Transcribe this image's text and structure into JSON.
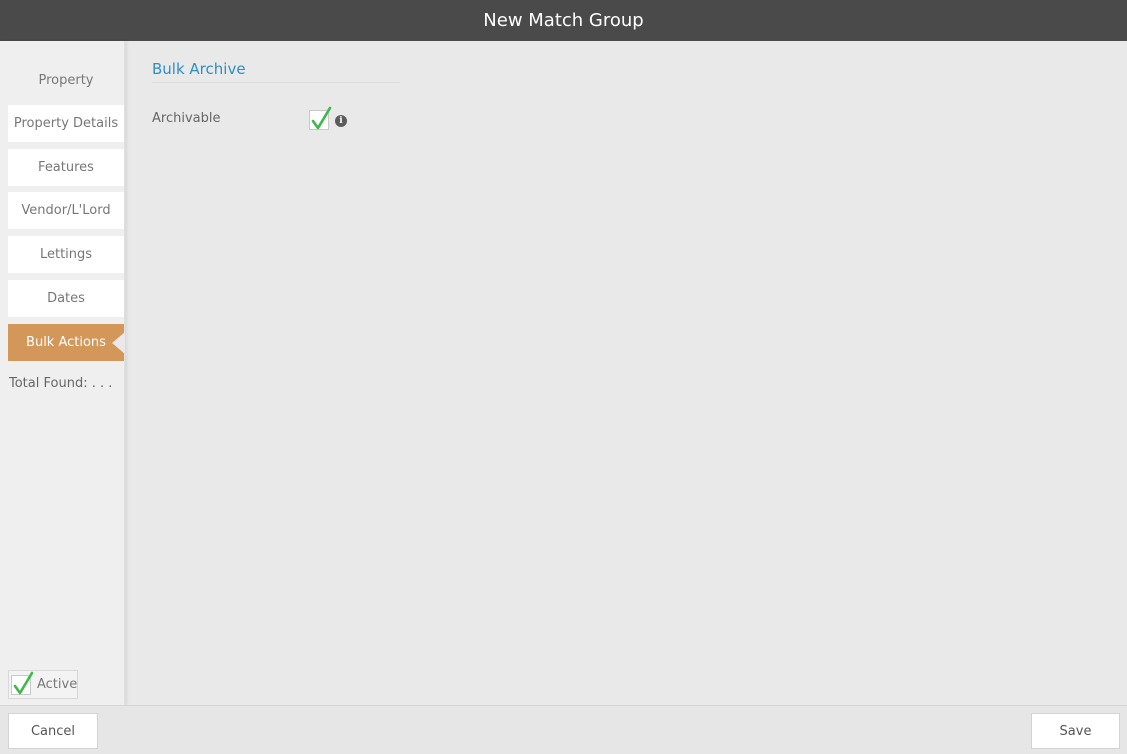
{
  "window": {
    "title": "New Match Group"
  },
  "sidebar": {
    "items": [
      {
        "label": "Property"
      },
      {
        "label": "Property Details"
      },
      {
        "label": "Features"
      },
      {
        "label": "Vendor/L'Lord"
      },
      {
        "label": "Lettings"
      },
      {
        "label": "Dates"
      },
      {
        "label": "Bulk Actions",
        "active": true
      }
    ],
    "total_found": "Total Found: . . .",
    "active_toggle": {
      "label": "Active",
      "checked": true
    }
  },
  "main": {
    "section_title": "Bulk Archive",
    "fields": [
      {
        "label": "Archivable",
        "checked": true,
        "info_icon": "info-icon"
      }
    ]
  },
  "footer": {
    "cancel_label": "Cancel",
    "save_label": "Save"
  },
  "colors": {
    "titlebar": "#4a4a4a",
    "active_tab": "#d4975a",
    "section_title": "#2e8fc4",
    "check": "#3cb94a"
  }
}
